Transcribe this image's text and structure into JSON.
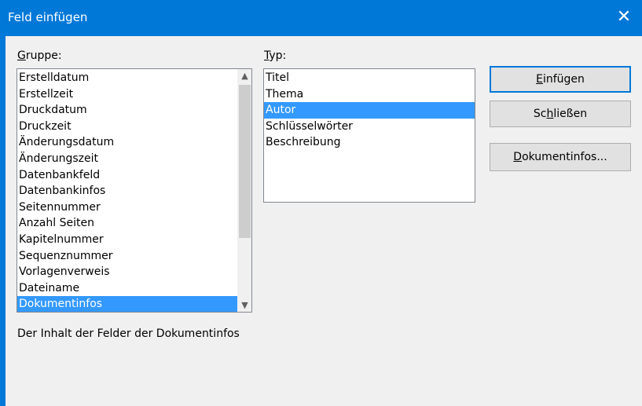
{
  "window": {
    "title": "Feld einfügen",
    "close_glyph": "✕"
  },
  "group": {
    "label": "Gruppe:",
    "items": [
      "Erstelldatum",
      "Erstellzeit",
      "Druckdatum",
      "Druckzeit",
      "Änderungsdatum",
      "Änderungszeit",
      "Datenbankfeld",
      "Datenbankinfos",
      "Seitennummer",
      "Anzahl Seiten",
      "Kapitelnummer",
      "Sequenznummer",
      "Vorlagenverweis",
      "Dateiname",
      "Dokumentinfos"
    ],
    "selected": "Dokumentinfos"
  },
  "type": {
    "label": "Typ:",
    "items": [
      "Titel",
      "Thema",
      "Autor",
      "Schlüsselwörter",
      "Beschreibung"
    ],
    "selected": "Autor"
  },
  "buttons": {
    "insert": "Einfügen",
    "close": "Schließen",
    "docinfo": "Dokumentinfos..."
  },
  "description": "Der Inhalt der Felder der Dokumentinfos"
}
